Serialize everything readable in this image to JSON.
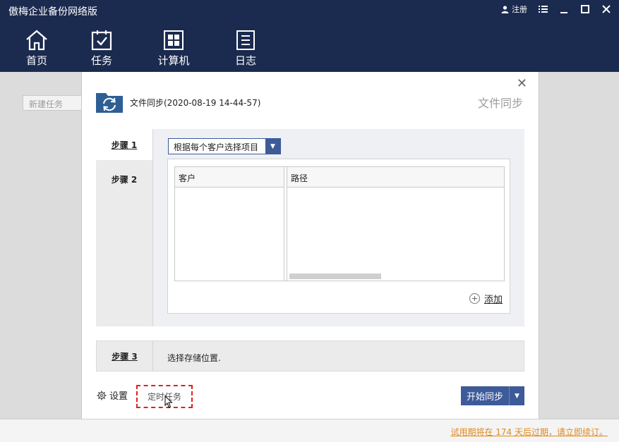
{
  "app": {
    "title": "傲梅企业备份网络版",
    "register_label": "注册"
  },
  "nav": {
    "home": "首页",
    "tasks": "任务",
    "computers": "计算机",
    "logs": "日志"
  },
  "background": {
    "new_task_placeholder": "新建任务"
  },
  "dialog": {
    "title": "文件同步(2020-08-19 14-44-57)",
    "type_label": "文件同步",
    "steps": [
      {
        "label": "步骤 1"
      },
      {
        "label": "步骤 2"
      },
      {
        "label": "步骤 3",
        "description": "选择存储位置."
      }
    ],
    "select_value": "根据每个客户选择项目",
    "table": {
      "columns": [
        "客户",
        "路径"
      ],
      "rows": []
    },
    "add_label": "添加",
    "settings_label": "设置",
    "schedule_label": "定时任务",
    "start_label": "开始同步"
  },
  "footer": {
    "trial_text": "试用期将在 174 天后过期，请立即续订。"
  },
  "colors": {
    "header_bg": "#1b2a4f",
    "accent": "#3d5a99",
    "trial_link": "#e08a1e",
    "highlight_border": "#e02020"
  }
}
